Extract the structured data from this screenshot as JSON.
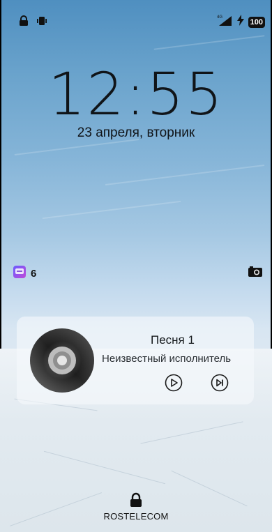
{
  "status_bar": {
    "left_icons": [
      "lock-icon",
      "vibrate-icon"
    ],
    "network": "4G",
    "battery": "100"
  },
  "lock_screen": {
    "time": "12:55",
    "date": "23 апреля, вторник"
  },
  "notifications": {
    "app_icon": "messages-icon",
    "count": "6",
    "right_icon": "camera-icon"
  },
  "media": {
    "title": "Песня 1",
    "artist": "Неизвестный исполнитель",
    "controls": [
      "play-icon",
      "skip-next-icon"
    ]
  },
  "footer": {
    "carrier": "ROSTELECOM",
    "icon": "lock-icon"
  },
  "colors": {
    "sky_top": "#4f8fc0",
    "ice": "#e4ecf2",
    "text": "#101418"
  }
}
